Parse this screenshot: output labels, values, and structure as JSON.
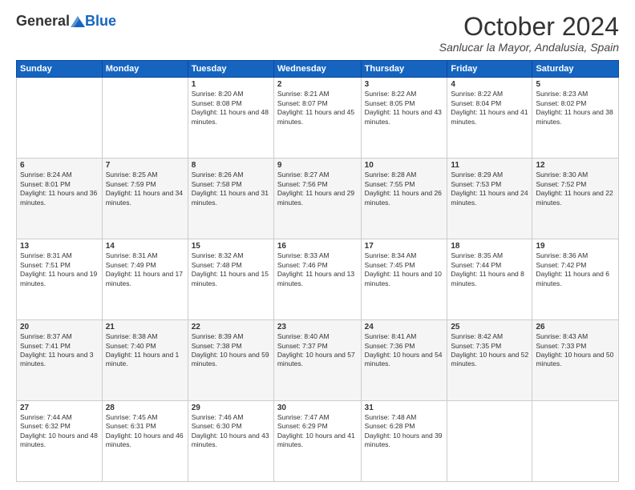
{
  "header": {
    "logo_general": "General",
    "logo_blue": "Blue",
    "month_title": "October 2024",
    "location": "Sanlucar la Mayor, Andalusia, Spain"
  },
  "weekdays": [
    "Sunday",
    "Monday",
    "Tuesday",
    "Wednesday",
    "Thursday",
    "Friday",
    "Saturday"
  ],
  "weeks": [
    [
      {
        "day": "",
        "info": ""
      },
      {
        "day": "",
        "info": ""
      },
      {
        "day": "1",
        "info": "Sunrise: 8:20 AM\nSunset: 8:08 PM\nDaylight: 11 hours and 48 minutes."
      },
      {
        "day": "2",
        "info": "Sunrise: 8:21 AM\nSunset: 8:07 PM\nDaylight: 11 hours and 45 minutes."
      },
      {
        "day": "3",
        "info": "Sunrise: 8:22 AM\nSunset: 8:05 PM\nDaylight: 11 hours and 43 minutes."
      },
      {
        "day": "4",
        "info": "Sunrise: 8:22 AM\nSunset: 8:04 PM\nDaylight: 11 hours and 41 minutes."
      },
      {
        "day": "5",
        "info": "Sunrise: 8:23 AM\nSunset: 8:02 PM\nDaylight: 11 hours and 38 minutes."
      }
    ],
    [
      {
        "day": "6",
        "info": "Sunrise: 8:24 AM\nSunset: 8:01 PM\nDaylight: 11 hours and 36 minutes."
      },
      {
        "day": "7",
        "info": "Sunrise: 8:25 AM\nSunset: 7:59 PM\nDaylight: 11 hours and 34 minutes."
      },
      {
        "day": "8",
        "info": "Sunrise: 8:26 AM\nSunset: 7:58 PM\nDaylight: 11 hours and 31 minutes."
      },
      {
        "day": "9",
        "info": "Sunrise: 8:27 AM\nSunset: 7:56 PM\nDaylight: 11 hours and 29 minutes."
      },
      {
        "day": "10",
        "info": "Sunrise: 8:28 AM\nSunset: 7:55 PM\nDaylight: 11 hours and 26 minutes."
      },
      {
        "day": "11",
        "info": "Sunrise: 8:29 AM\nSunset: 7:53 PM\nDaylight: 11 hours and 24 minutes."
      },
      {
        "day": "12",
        "info": "Sunrise: 8:30 AM\nSunset: 7:52 PM\nDaylight: 11 hours and 22 minutes."
      }
    ],
    [
      {
        "day": "13",
        "info": "Sunrise: 8:31 AM\nSunset: 7:51 PM\nDaylight: 11 hours and 19 minutes."
      },
      {
        "day": "14",
        "info": "Sunrise: 8:31 AM\nSunset: 7:49 PM\nDaylight: 11 hours and 17 minutes."
      },
      {
        "day": "15",
        "info": "Sunrise: 8:32 AM\nSunset: 7:48 PM\nDaylight: 11 hours and 15 minutes."
      },
      {
        "day": "16",
        "info": "Sunrise: 8:33 AM\nSunset: 7:46 PM\nDaylight: 11 hours and 13 minutes."
      },
      {
        "day": "17",
        "info": "Sunrise: 8:34 AM\nSunset: 7:45 PM\nDaylight: 11 hours and 10 minutes."
      },
      {
        "day": "18",
        "info": "Sunrise: 8:35 AM\nSunset: 7:44 PM\nDaylight: 11 hours and 8 minutes."
      },
      {
        "day": "19",
        "info": "Sunrise: 8:36 AM\nSunset: 7:42 PM\nDaylight: 11 hours and 6 minutes."
      }
    ],
    [
      {
        "day": "20",
        "info": "Sunrise: 8:37 AM\nSunset: 7:41 PM\nDaylight: 11 hours and 3 minutes."
      },
      {
        "day": "21",
        "info": "Sunrise: 8:38 AM\nSunset: 7:40 PM\nDaylight: 11 hours and 1 minute."
      },
      {
        "day": "22",
        "info": "Sunrise: 8:39 AM\nSunset: 7:38 PM\nDaylight: 10 hours and 59 minutes."
      },
      {
        "day": "23",
        "info": "Sunrise: 8:40 AM\nSunset: 7:37 PM\nDaylight: 10 hours and 57 minutes."
      },
      {
        "day": "24",
        "info": "Sunrise: 8:41 AM\nSunset: 7:36 PM\nDaylight: 10 hours and 54 minutes."
      },
      {
        "day": "25",
        "info": "Sunrise: 8:42 AM\nSunset: 7:35 PM\nDaylight: 10 hours and 52 minutes."
      },
      {
        "day": "26",
        "info": "Sunrise: 8:43 AM\nSunset: 7:33 PM\nDaylight: 10 hours and 50 minutes."
      }
    ],
    [
      {
        "day": "27",
        "info": "Sunrise: 7:44 AM\nSunset: 6:32 PM\nDaylight: 10 hours and 48 minutes."
      },
      {
        "day": "28",
        "info": "Sunrise: 7:45 AM\nSunset: 6:31 PM\nDaylight: 10 hours and 46 minutes."
      },
      {
        "day": "29",
        "info": "Sunrise: 7:46 AM\nSunset: 6:30 PM\nDaylight: 10 hours and 43 minutes."
      },
      {
        "day": "30",
        "info": "Sunrise: 7:47 AM\nSunset: 6:29 PM\nDaylight: 10 hours and 41 minutes."
      },
      {
        "day": "31",
        "info": "Sunrise: 7:48 AM\nSunset: 6:28 PM\nDaylight: 10 hours and 39 minutes."
      },
      {
        "day": "",
        "info": ""
      },
      {
        "day": "",
        "info": ""
      }
    ]
  ]
}
